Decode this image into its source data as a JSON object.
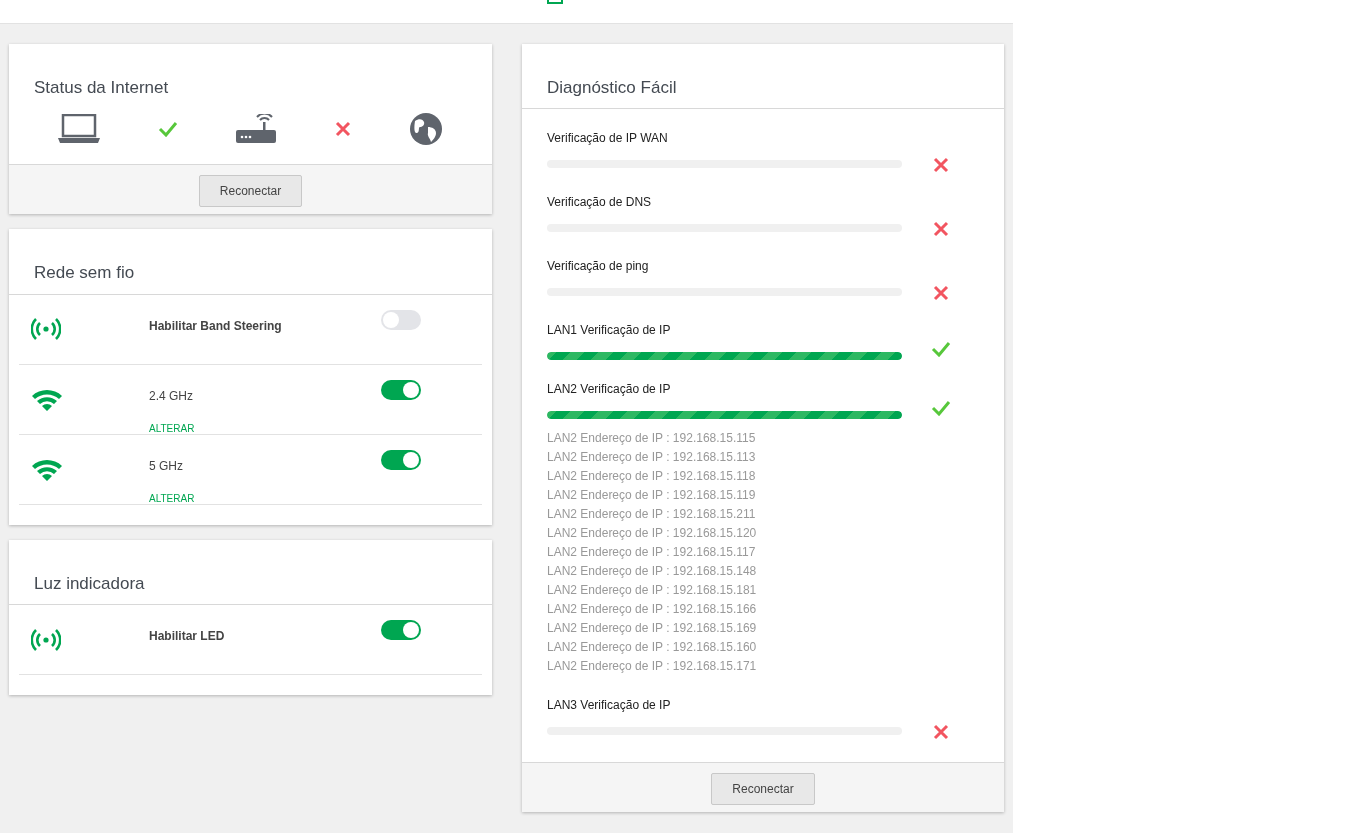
{
  "internet_status": {
    "title": "Status da Internet",
    "nodes": [
      {
        "kind": "laptop"
      },
      {
        "kind": "ok"
      },
      {
        "kind": "router"
      },
      {
        "kind": "fail"
      },
      {
        "kind": "globe"
      }
    ],
    "button": "Reconectar"
  },
  "wireless": {
    "title": "Rede sem fio",
    "rows": [
      {
        "kind": "band",
        "label": "Habilitar Band Steering",
        "on": false
      },
      {
        "kind": "wifi",
        "label": "2.4 GHz",
        "on": true,
        "link": "ALTERAR"
      },
      {
        "kind": "wifi",
        "label": "5 GHz",
        "on": true,
        "link": "ALTERAR"
      }
    ]
  },
  "indicator": {
    "title": "Luz indicadora",
    "rows": [
      {
        "kind": "band",
        "label": "Habilitar LED",
        "on": true
      }
    ]
  },
  "diagnostics": {
    "title": "Diagnóstico Fácil",
    "checks": [
      {
        "label": "Verificação de IP WAN",
        "level": 0,
        "passed": false
      },
      {
        "label": "Verificação de DNS",
        "level": 0,
        "passed": false
      },
      {
        "label": "Verificação de ping",
        "level": 0,
        "passed": false
      },
      {
        "label": "LAN1 Verificação de IP",
        "level": 1,
        "passed": true
      },
      {
        "label": "LAN2 Verificação de IP",
        "level": 1,
        "passed": true,
        "addresses": [
          "LAN2 Endereço de IP : 192.168.15.115",
          "LAN2 Endereço de IP : 192.168.15.113",
          "LAN2 Endereço de IP : 192.168.15.118",
          "LAN2 Endereço de IP : 192.168.15.119",
          "LAN2 Endereço de IP : 192.168.15.211",
          "LAN2 Endereço de IP : 192.168.15.120",
          "LAN2 Endereço de IP : 192.168.15.117",
          "LAN2 Endereço de IP : 192.168.15.148",
          "LAN2 Endereço de IP : 192.168.15.181",
          "LAN2 Endereço de IP : 192.168.15.166",
          "LAN2 Endereço de IP : 192.168.15.169",
          "LAN2 Endereço de IP : 192.168.15.160",
          "LAN2 Endereço de IP : 192.168.15.171"
        ]
      },
      {
        "label": "LAN3 Verificação de IP",
        "level": 0,
        "passed": false
      }
    ],
    "button": "Reconectar"
  }
}
